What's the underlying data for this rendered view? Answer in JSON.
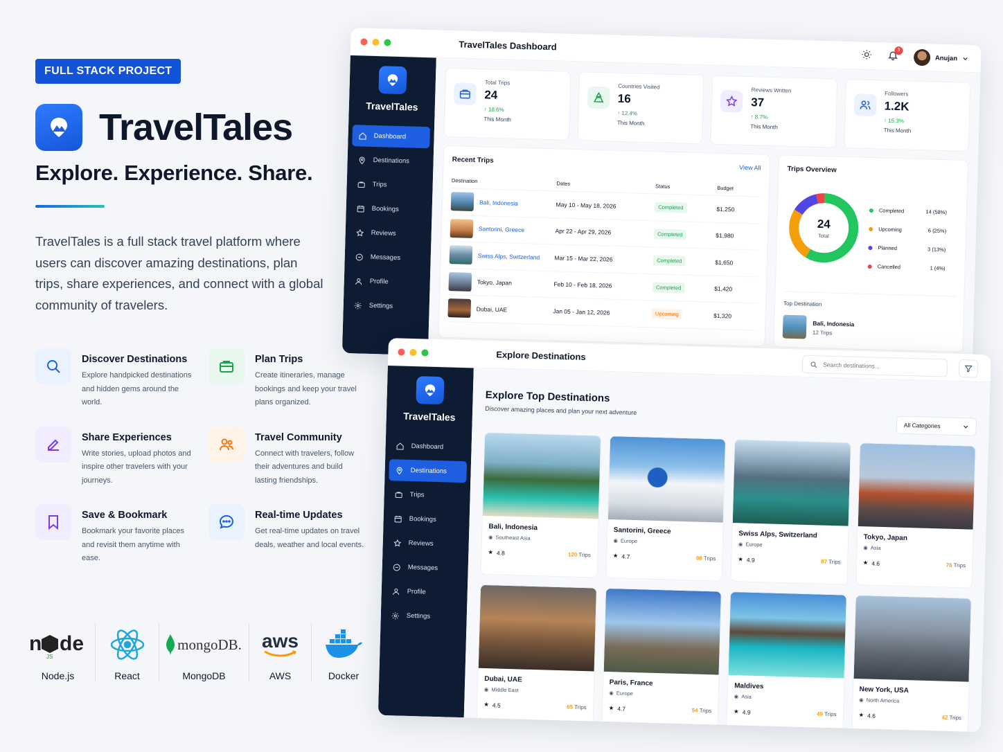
{
  "badge": "FULL STACK PROJECT",
  "brand": {
    "name": "TravelTales",
    "tagline": "Explore. Experience. Share."
  },
  "intro": "TravelTales is a full stack travel platform where users can discover amazing destinations, plan trips, share experiences, and connect with a global community of travelers.",
  "features": [
    {
      "title": "Discover Destinations",
      "desc": "Explore handpicked destinations and hidden gems around the world.",
      "icon": "search-icon",
      "color": "#1d5fe0"
    },
    {
      "title": "Plan Trips",
      "desc": "Create itineraries, manage bookings and keep your travel plans organized.",
      "icon": "suitcase-icon",
      "color": "#16a34a"
    },
    {
      "title": "Share Experiences",
      "desc": "Write stories, upload photos and inspire other travelers with your journeys.",
      "icon": "edit-icon",
      "color": "#7c3aed"
    },
    {
      "title": "Travel Community",
      "desc": "Connect with travelers, follow their adventures and build lasting friendships.",
      "icon": "users-icon",
      "color": "#f97316"
    },
    {
      "title": "Save & Bookmark",
      "desc": "Bookmark your favorite places and revisit them anytime with ease.",
      "icon": "bookmark-icon",
      "color": "#7c3aed"
    },
    {
      "title": "Real-time Updates",
      "desc": "Get real-time updates on travel deals, weather and local events.",
      "icon": "chat-icon",
      "color": "#1d5fe0"
    }
  ],
  "tech": [
    {
      "label": "Node.js",
      "icon": "nodejs-icon"
    },
    {
      "label": "React",
      "icon": "react-icon"
    },
    {
      "label": "MongoDB",
      "icon": "mongodb-icon",
      "wordmark": "mongoDB."
    },
    {
      "label": "AWS",
      "icon": "aws-icon",
      "wordmark": "aws"
    },
    {
      "label": "Docker",
      "icon": "docker-icon"
    }
  ],
  "dashboard": {
    "title": "TravelTales Dashboard",
    "sidebar_name": "TravelTales",
    "user": {
      "name": "Anujan",
      "notifications": "3"
    },
    "nav": [
      {
        "label": "Dashboard",
        "icon": "home-icon",
        "active": true
      },
      {
        "label": "Destinations",
        "icon": "pin-icon"
      },
      {
        "label": "Trips",
        "icon": "suitcase-icon"
      },
      {
        "label": "Bookings",
        "icon": "calendar-icon"
      },
      {
        "label": "Reviews",
        "icon": "star-icon"
      },
      {
        "label": "Messages",
        "icon": "chat-icon"
      },
      {
        "label": "Profile",
        "icon": "user-icon"
      },
      {
        "label": "Settings",
        "icon": "gear-icon"
      }
    ],
    "stats": [
      {
        "label": "Total Trips",
        "value": "24",
        "change": "18.6%",
        "sub": "This Month",
        "color": "#1d5fe0",
        "bg": "#eaf1ff",
        "icon": "suitcase-icon"
      },
      {
        "label": "Countries Visited",
        "value": "16",
        "change": "12.4%",
        "sub": "This Month",
        "color": "#16a34a",
        "bg": "#e8f8ee",
        "icon": "map-icon"
      },
      {
        "label": "Reviews Written",
        "value": "37",
        "change": "8.7%",
        "sub": "This Month",
        "color": "#7c3aed",
        "bg": "#f1ecff",
        "icon": "star-icon"
      },
      {
        "label": "Followers",
        "value": "1.2K",
        "change": "15.3%",
        "sub": "This Month",
        "color": "#1d5fe0",
        "bg": "#eaf1ff",
        "icon": "users-icon"
      }
    ],
    "recent_trips": {
      "title": "Recent Trips",
      "view_all": "View All",
      "columns": [
        "Destination",
        "Dates",
        "Status",
        "Budget"
      ],
      "rows": [
        {
          "destination": "Bali, Indonesia",
          "dates": "May 10 - May 18, 2026",
          "status": "Completed",
          "budget": "$1,250",
          "link": true
        },
        {
          "destination": "Santorini, Greece",
          "dates": "Apr 22 - Apr 29, 2026",
          "status": "Completed",
          "budget": "$1,980",
          "link": true
        },
        {
          "destination": "Swiss Alps, Switzerland",
          "dates": "Mar 15 - Mar 22, 2026",
          "status": "Completed",
          "budget": "$1,650",
          "link": true
        },
        {
          "destination": "Tokyo, Japan",
          "dates": "Feb 10 - Feb 18, 2026",
          "status": "Completed",
          "budget": "$1,420",
          "link": false
        },
        {
          "destination": "Dubai, UAE",
          "dates": "Jan 05 - Jan 12, 2026",
          "status": "Upcoming",
          "budget": "$1,320",
          "link": false
        }
      ]
    },
    "overview": {
      "title": "Trips Overview",
      "total": "24",
      "total_label": "Total",
      "segments": [
        {
          "label": "Completed",
          "count": 14,
          "value": "14 (58%)",
          "color": "#22c55e"
        },
        {
          "label": "Upcoming",
          "count": 6,
          "value": "6 (25%)",
          "color": "#f59e0b"
        },
        {
          "label": "Planned",
          "count": 3,
          "value": "3 (13%)",
          "color": "#4f46e5"
        },
        {
          "label": "Cancelled",
          "count": 1,
          "value": "1 (4%)",
          "color": "#ef4444"
        }
      ],
      "top_destination": {
        "label": "Top Destination",
        "name": "Bali, Indonesia",
        "trips": "12 Trips"
      }
    }
  },
  "explore": {
    "title": "Explore Destinations",
    "sidebar_name": "TravelTales",
    "search_placeholder": "Search destinations...",
    "heading": "Explore Top Destinations",
    "subheading": "Discover amazing places and plan your next adventure",
    "category": "All Categories",
    "nav": [
      {
        "label": "Dashboard",
        "icon": "home-icon"
      },
      {
        "label": "Destinations",
        "icon": "pin-icon",
        "active": true
      },
      {
        "label": "Trips",
        "icon": "suitcase-icon"
      },
      {
        "label": "Bookings",
        "icon": "calendar-icon"
      },
      {
        "label": "Reviews",
        "icon": "star-icon"
      },
      {
        "label": "Messages",
        "icon": "chat-icon"
      },
      {
        "label": "Profile",
        "icon": "user-icon"
      },
      {
        "label": "Settings",
        "icon": "gear-icon"
      }
    ],
    "cards": [
      {
        "name": "Bali, Indonesia",
        "region": "Southeast Asia",
        "rating": "4.8",
        "trips_num": "120",
        "trips_label": "Trips"
      },
      {
        "name": "Santorini, Greece",
        "region": "Europe",
        "rating": "4.7",
        "trips_num": "98",
        "trips_label": "Trips"
      },
      {
        "name": "Swiss Alps, Switzerland",
        "region": "Europe",
        "rating": "4.9",
        "trips_num": "87",
        "trips_label": "Trips"
      },
      {
        "name": "Tokyo, Japan",
        "region": "Asia",
        "rating": "4.6",
        "trips_num": "76",
        "trips_label": "Trips"
      },
      {
        "name": "Dubai, UAE",
        "region": "Middle East",
        "rating": "4.5",
        "trips_num": "65",
        "trips_label": "Trips"
      },
      {
        "name": "Paris, France",
        "region": "Europe",
        "rating": "4.7",
        "trips_num": "54",
        "trips_label": "Trips"
      },
      {
        "name": "Maldives",
        "region": "Asia",
        "rating": "4.9",
        "trips_num": "49",
        "trips_label": "Trips"
      },
      {
        "name": "New York, USA",
        "region": "North America",
        "rating": "4.6",
        "trips_num": "42",
        "trips_label": "Trips"
      }
    ]
  }
}
